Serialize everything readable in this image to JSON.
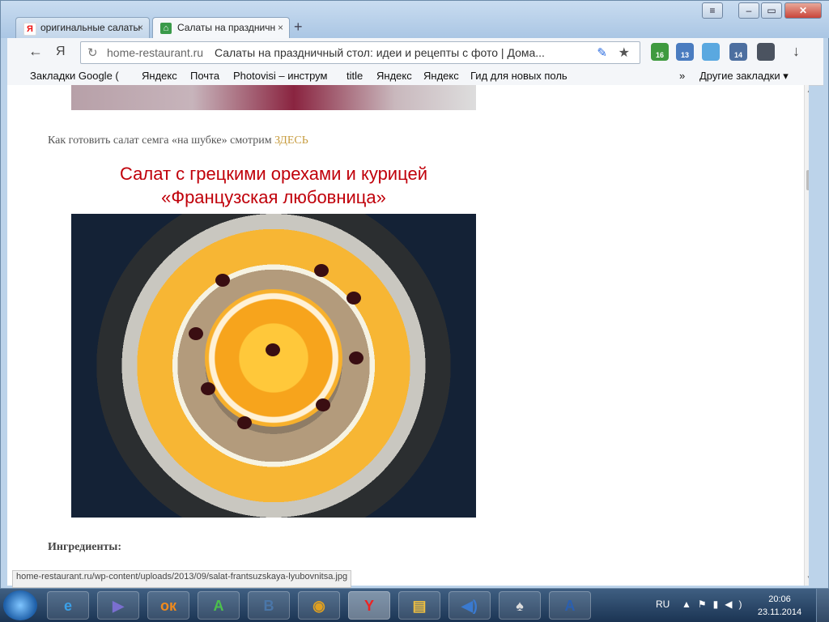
{
  "browser": {
    "tabs": [
      {
        "label": "оригинальные салаты",
        "favicon": "yandex-icon",
        "close": "×"
      },
      {
        "label": "Салаты на праздничн",
        "favicon": "home-restaurant-icon",
        "close": "×"
      }
    ],
    "new_tab": "+",
    "window_buttons": {
      "menu": "≡",
      "minimize": "–",
      "maximize": "▭",
      "close": "✕"
    },
    "toolbar": {
      "back": "←",
      "yandex": "Я"
    },
    "omnibox": {
      "host": "home-restaurant.ru",
      "title": "Салаты на праздничный стол: идеи и рецепты с фото | Дома..."
    },
    "extensions": [
      {
        "name": "extension-16",
        "badge": "16",
        "color": "#3f9a3f"
      },
      {
        "name": "extension-13",
        "badge": "13",
        "color": "#4a7cc0"
      },
      {
        "name": "weather-extension",
        "badge": "",
        "color": "#5aa8e0"
      },
      {
        "name": "extension-14",
        "badge": "14",
        "color": "#4d6fa0"
      },
      {
        "name": "pocket-extension",
        "badge": "",
        "color": "#4b5360"
      }
    ],
    "download": "↓",
    "bookmarks": [
      "Закладки Google (",
      "Яндекс",
      "Почта",
      "Photovisi – инструм",
      "title",
      "Яндекс",
      "Яндекс",
      "Гид для новых поль"
    ],
    "bookmarks_more": "»",
    "other_bookmarks": "Другие закладки ▾"
  },
  "page": {
    "see_text": "Как готовить салат семга «на шубке» смотрим",
    "see_link": "ЗДЕСЬ",
    "recipe_title_line1": "Салат с грецкими орехами и курицей",
    "recipe_title_line2": "«Французская любовница»",
    "ingredients_heading": "Ингредиенты:",
    "status_url": "home-restaurant.ru/wp-content/uploads/2013/09/salat-frantsuzskaya-lyubovnitsa.jpg"
  },
  "taskbar": {
    "apps": [
      {
        "name": "internet-explorer",
        "glyph": "e",
        "color": "#3aa0e8"
      },
      {
        "name": "media-player",
        "glyph": "▶",
        "color": "#7a6fd0"
      },
      {
        "name": "odnoklassniki",
        "glyph": "ок",
        "color": "#f08a1c"
      },
      {
        "name": "app-a",
        "glyph": "A",
        "color": "#4cc04c"
      },
      {
        "name": "vkontakte",
        "glyph": "B",
        "color": "#4a76a8"
      },
      {
        "name": "chrome",
        "glyph": "◉",
        "color": "#e0a020"
      },
      {
        "name": "yandex-browser",
        "glyph": "Y",
        "color": "#e22"
      },
      {
        "name": "explorer",
        "glyph": "▤",
        "color": "#f0c040"
      },
      {
        "name": "audio",
        "glyph": "◀)",
        "color": "#3a7ad0"
      },
      {
        "name": "solitaire",
        "glyph": "♠",
        "color": "#ddd"
      },
      {
        "name": "word-app",
        "glyph": "A",
        "color": "#2a5fb0"
      }
    ],
    "language": "RU",
    "time": "20:06",
    "date": "23.11.2014"
  }
}
